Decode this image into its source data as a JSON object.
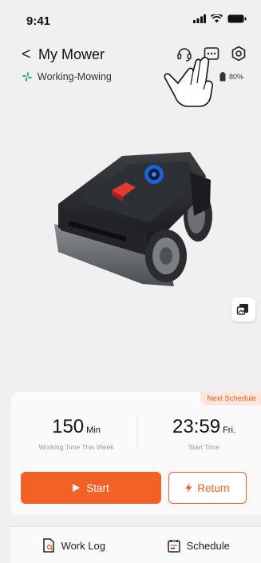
{
  "status_bar": {
    "time": "9:41"
  },
  "header": {
    "title": "My Mower",
    "back_glyph": "<"
  },
  "device": {
    "state": "Working-Mowing",
    "battery": "80%"
  },
  "next_schedule": {
    "badge": "Next Schedule",
    "working_time_value": "150",
    "working_time_unit": "Min",
    "working_time_label": "Working Time This Week",
    "start_time_value": "23:59",
    "start_time_day": "Fri.",
    "start_time_label": "Start Time"
  },
  "actions": {
    "start_label": "Start",
    "return_label": "Return"
  },
  "nav": {
    "work_log": "Work Log",
    "schedule": "Schedule"
  },
  "colors": {
    "accent": "#f26126",
    "status_green": "#2bb673"
  },
  "icons": [
    "headset-icon",
    "more-icon",
    "settings-icon",
    "fan-icon",
    "battery-icon",
    "map-view-icon",
    "play-icon",
    "lightning-icon",
    "work-log-icon",
    "schedule-icon",
    "hand-pointer-icon"
  ]
}
